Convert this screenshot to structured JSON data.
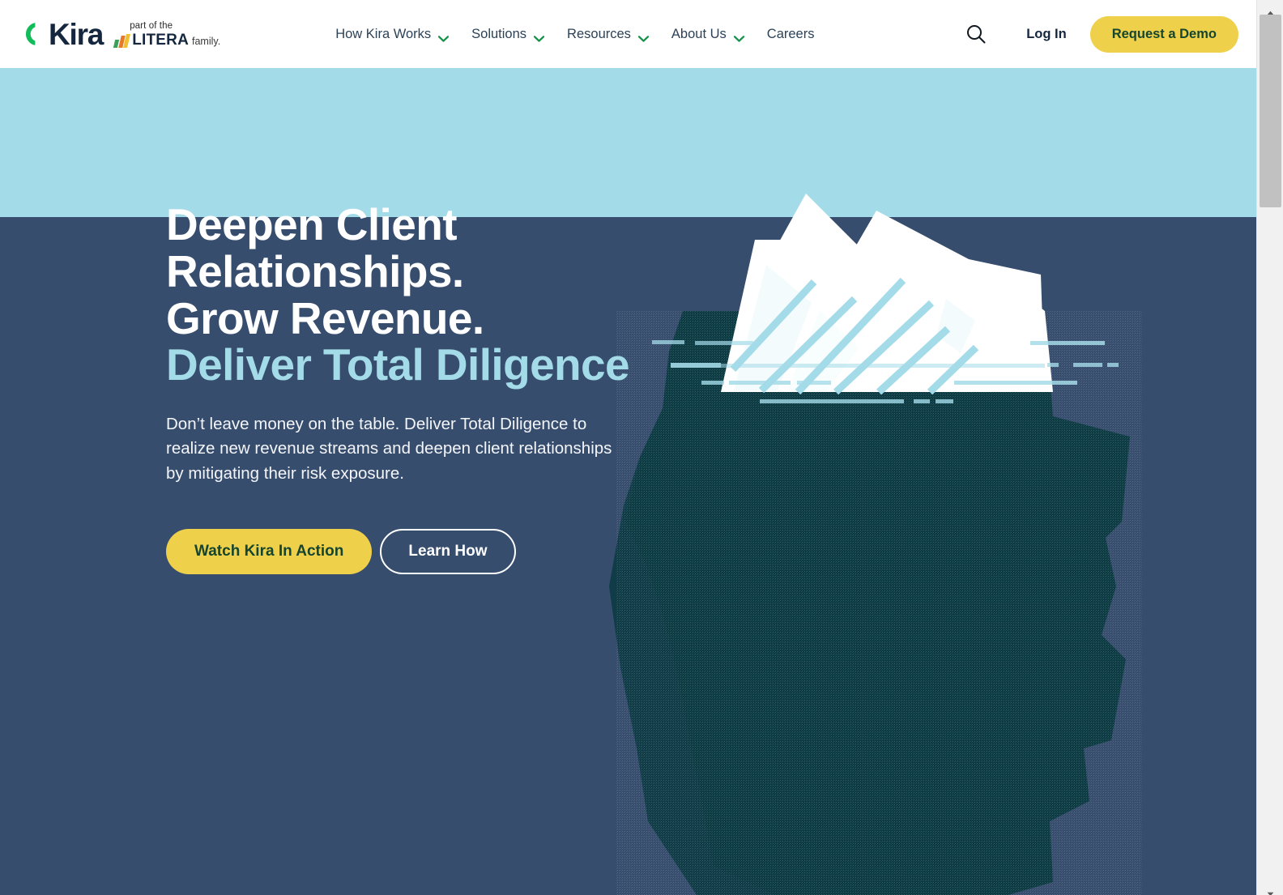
{
  "brand": {
    "name": "Kira",
    "mark_icon": "kira-bracket-icon",
    "mark_color": "#14bb5a",
    "wordmark_color": "#15263f",
    "affiliate_line1": "part of the",
    "affiliate_name": "LITERA",
    "affiliate_suffix": "family.",
    "affiliate_bar_colors": [
      "#3aa05a",
      "#e77a28",
      "#f0c030"
    ]
  },
  "nav": {
    "items": [
      {
        "label": "How Kira Works",
        "has_dropdown": true,
        "icon": "chevron-down-icon"
      },
      {
        "label": "Solutions",
        "has_dropdown": true,
        "icon": "chevron-down-icon"
      },
      {
        "label": "Resources",
        "has_dropdown": true,
        "icon": "chevron-down-icon"
      },
      {
        "label": "About Us",
        "has_dropdown": true,
        "icon": "chevron-down-icon"
      },
      {
        "label": "Careers",
        "has_dropdown": false,
        "icon": ""
      }
    ],
    "chevron_color": "#17914a",
    "text_color": "#2c4257"
  },
  "header_actions": {
    "search_icon": "search-icon",
    "login_label": "Log In",
    "demo_label": "Request a Demo",
    "demo_bg": "#eed04a",
    "demo_text_color": "#15452e"
  },
  "hero": {
    "headline_line1": "Deepen Client",
    "headline_line2": "Relationships.",
    "headline_line3": "Grow Revenue.",
    "headline_line4_accent": "Deliver Total Diligence",
    "accent_color": "#a4dbe8",
    "subcopy": "Don’t leave money on the table. Deliver Total Diligence to realize new revenue streams and deepen client relationships by mitigating their risk exposure.",
    "primary_cta": "Watch Kira In Action",
    "secondary_cta": "Learn How",
    "sky_color": "#a4dbe8",
    "sea_color": "#374d6e",
    "iceberg_above_color": "#ffffff",
    "iceberg_below_color": "#0d3b43"
  },
  "browser": {
    "scrollbar_track": "#f1f1f1",
    "scrollbar_thumb": "#c1c1c1",
    "scroll_up_icon": "scroll-up-arrow-icon",
    "scroll_down_icon": "scroll-down-arrow-icon"
  }
}
